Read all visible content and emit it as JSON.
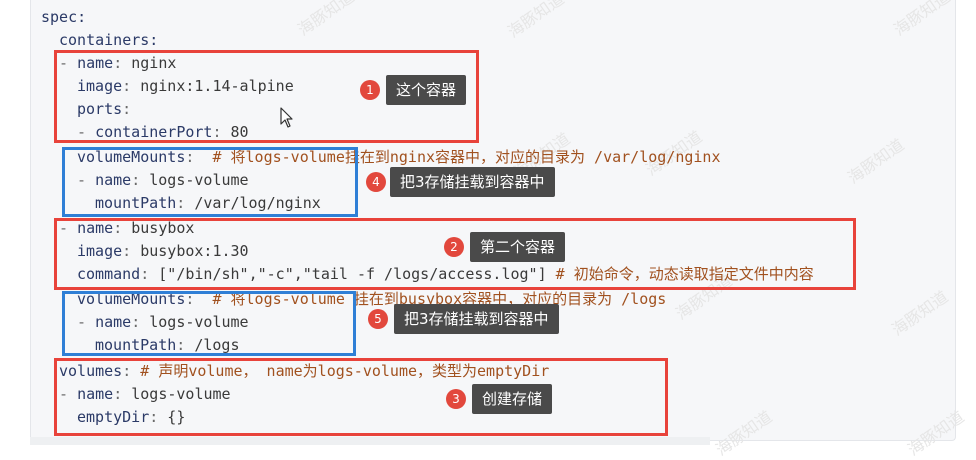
{
  "code": {
    "l1": "spec:",
    "l2": "containers:",
    "l3_dash": "- ",
    "l3_key": "name",
    "l3_val": " nginx",
    "l4_key": "image",
    "l4_val": " nginx:1.14-alpine",
    "l5_key": "ports",
    "l6_dash": "- ",
    "l6_key": "containerPort",
    "l6_val": " 80",
    "l7_key": "volumeMounts",
    "l7_comment": "  # 将logs-volume挂在到nginx容器中，对应的目录为 /var/log/nginx",
    "l8_dash": "- ",
    "l8_key": "name",
    "l8_val": " logs-volume",
    "l9_key": "mountPath",
    "l9_val": " /var/log/nginx",
    "l10_dash": "- ",
    "l10_key": "name",
    "l10_val": " busybox",
    "l11_key": "image",
    "l11_val": " busybox:1.30",
    "l12_key": "command",
    "l12_val": " [\"/bin/sh\",\"-c\",\"tail -f /logs/access.log\"]",
    "l12_comment": " # 初始命令，动态读取指定文件中内容",
    "l13_key": "volumeMounts",
    "l13_comment": "  # 将logs-volume 挂在到busybox容器中，对应的目录为 /logs",
    "l14_dash": "- ",
    "l14_key": "name",
    "l14_val": " logs-volume",
    "l15_key": "mountPath",
    "l15_val": " /logs",
    "l16_key": "volumes",
    "l16_comment": " # 声明volume， name为logs-volume，类型为emptyDir",
    "l17_dash": "- ",
    "l17_key": "name",
    "l17_val": " logs-volume",
    "l18_key": "emptyDir",
    "l18_val": " {}",
    "colon": ":"
  },
  "annotations": [
    {
      "num": "1",
      "label": "这个容器"
    },
    {
      "num": "4",
      "label": "把3存储挂载到容器中"
    },
    {
      "num": "2",
      "label": "第二个容器"
    },
    {
      "num": "5",
      "label": "把3存储挂载到容器中"
    },
    {
      "num": "3",
      "label": "创建存储"
    }
  ],
  "watermark": "海豚知道",
  "colors": {
    "red_box": "#e8433b",
    "blue_box": "#2f7fd6",
    "badge": "#e2483d",
    "callout_bg": "#4a4a4a",
    "comment": "#a1511f"
  }
}
